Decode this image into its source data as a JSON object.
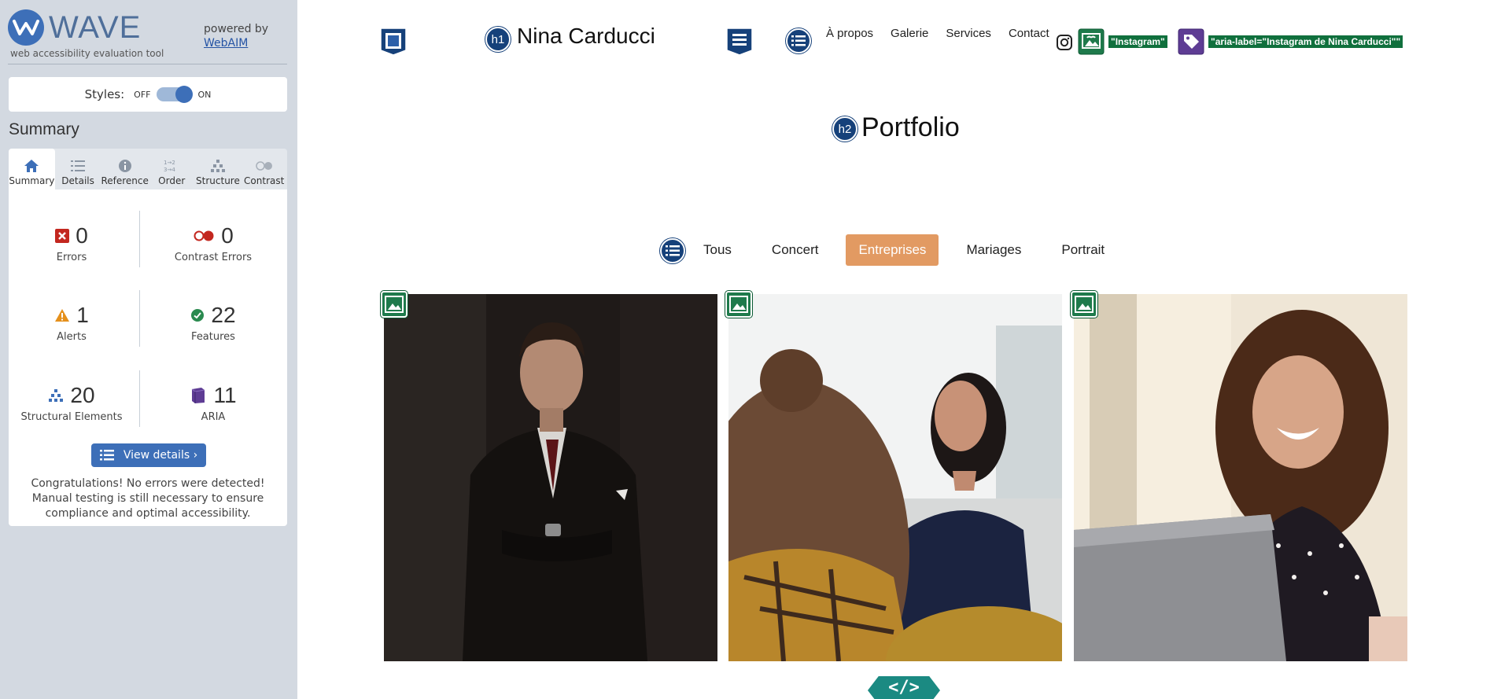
{
  "wave": {
    "logo_text": "WAVE",
    "tagline": "web accessibility evaluation tool",
    "powered_by": "powered by",
    "webaim_link": "WebAIM",
    "styles_label": "Styles:",
    "toggle_off": "OFF",
    "toggle_on": "ON",
    "summary_heading": "Summary",
    "tabs": [
      {
        "label": "Summary",
        "icon": "home-icon",
        "active": true
      },
      {
        "label": "Details",
        "icon": "list-icon"
      },
      {
        "label": "Reference",
        "icon": "info-icon"
      },
      {
        "label": "Order",
        "icon": "order-icon"
      },
      {
        "label": "Structure",
        "icon": "structure-icon"
      },
      {
        "label": "Contrast",
        "icon": "contrast-icon"
      }
    ],
    "stats": {
      "errors": {
        "value": "0",
        "label": "Errors"
      },
      "contrast_errors": {
        "value": "0",
        "label": "Contrast Errors"
      },
      "alerts": {
        "value": "1",
        "label": "Alerts"
      },
      "features": {
        "value": "22",
        "label": "Features"
      },
      "structural": {
        "value": "20",
        "label": "Structural Elements"
      },
      "aria": {
        "value": "11",
        "label": "ARIA"
      }
    },
    "view_details_label": "View details ›",
    "congrats": "Congratulations! No errors were detected! Manual testing is still necessary to ensure compliance and optimal accessibility."
  },
  "site": {
    "h1_badge": "h1",
    "title": "Nina Carducci",
    "nav": [
      "À propos",
      "Galerie",
      "Services",
      "Contact"
    ],
    "tag_instagram": "\"Instagram\"",
    "tag_aria_label": "\"aria-label=\"Instagram de Nina Carducci\"\"",
    "h2_badge": "h2",
    "portfolio_title": "Portfolio",
    "filters": [
      {
        "label": "Tous",
        "active": false
      },
      {
        "label": "Concert",
        "active": false
      },
      {
        "label": "Entreprises",
        "active": true
      },
      {
        "label": "Mariages",
        "active": false
      },
      {
        "label": "Portrait",
        "active": false
      }
    ],
    "code_badge": "</>"
  },
  "colors": {
    "wave_blue": "#3d6fb8",
    "badge_navy": "#16417a",
    "feature_green": "#10703d",
    "active_filter": "#e29a62",
    "sidebar_bg": "#d3d9e1"
  }
}
